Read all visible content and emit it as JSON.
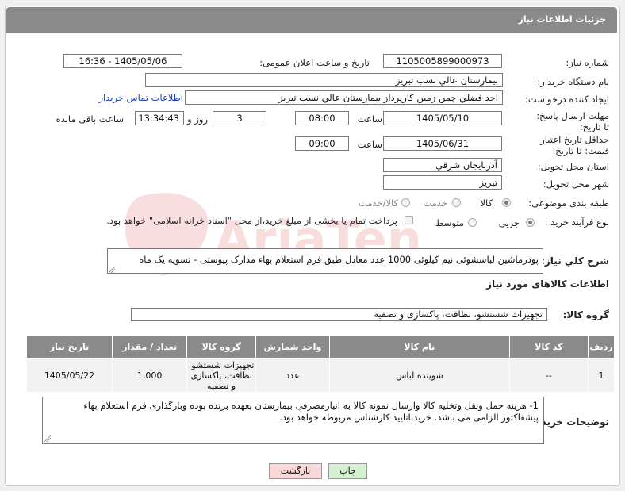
{
  "header": {
    "title": "جزئیات اطلاعات نیاز"
  },
  "labels": {
    "need_number": "شماره نیاز:",
    "announce_datetime": "تاریخ و ساعت اعلان عمومی:",
    "buyer_org": "نام دستگاه خریدار:",
    "requester": "ایجاد کننده درخواست:",
    "contact_link": "اطلاعات تماس خریدار",
    "reply_deadline": "مهلت ارسال پاسخ: تا تاریخ:",
    "time_word": "ساعت",
    "day_and": "روز و",
    "remaining": "ساعت باقی مانده",
    "price_validity": "حداقل تاریخ اعتبار قیمت: تا تاریخ:",
    "delivery_province": "استان محل تحویل:",
    "delivery_city": "شهر محل تحویل:",
    "subject_class": "طبقه بندی موضوعی:",
    "purchase_process": "نوع فرآیند خرید :",
    "general_desc": "شرح کلي نياز:",
    "goods_info": "اطلاعات کالاهای مورد نیاز",
    "goods_group": "گروه کالا:",
    "buyer_notes": "توضیحات خریدار:"
  },
  "fields": {
    "need_number": "1105005899000973",
    "announce_datetime": "1405/05/06 - 16:36",
    "buyer_org": "بيمارستان عالي نسب تبريز",
    "requester": "احد فضلي چمن زمين کارپرداز  بيمارستان عالي نسب تبريز",
    "reply_date": "1405/05/10",
    "reply_time": "08:00",
    "days": "3",
    "remaining_time": "13:34:43",
    "validity_date": "1405/06/31",
    "validity_time": "09:00",
    "province": "آذربايجان شرقي",
    "city": "تبريز",
    "description": "پودرماشین لباسشوئی نیم کیلوئی 1000 عدد   معادل طبق فرم استعلام بهاء مدارک پیوستی - تسویه یک ماه",
    "goods_group": "تجهیزات شستشو، نظافت، پاکسازی و تصفیه",
    "notes": "1- هزینه حمل ونقل وتخلیه کالا وارسال نمونه کالا به انبارمصرفی بیمارستان بعهده برنده بوده وبارگذاری فرم استعلام بهاء پیشفاکتور الزامی می باشد. خریدباتایید کارشناس مربوطه خواهد بود."
  },
  "subject_options": [
    {
      "label": "کالا",
      "selected": true
    },
    {
      "label": "خدمت",
      "selected": false
    },
    {
      "label": "کالا/خدمت",
      "selected": false
    }
  ],
  "process_options": [
    {
      "label": "جزیی",
      "selected": true
    },
    {
      "label": "متوسط",
      "selected": false
    }
  ],
  "payment_note": "پرداخت تمام یا بخشی از مبلغ خرید،از محل \"اسناد خزانه اسلامی\" خواهد بود.",
  "table": {
    "headers": [
      "ردیف",
      "کد کالا",
      "نام کالا",
      "واحد شمارش",
      "گروه کالا",
      "تعداد / مقدار",
      "تاریخ نیاز"
    ],
    "rows": [
      [
        "1",
        "--",
        "شوینده لباس",
        "عدد",
        "تجهیزات شستشو، نظافت، پاکسازی و تصفیه",
        "1,000",
        "1405/05/22"
      ]
    ]
  },
  "buttons": {
    "print": "چاپ",
    "back": "بازگشت"
  },
  "colors": {
    "header_bg": "#8a8a8a",
    "link": "#1a3fb5",
    "print_btn": "#d4f0d0",
    "back_btn": "#f8d8d8"
  }
}
